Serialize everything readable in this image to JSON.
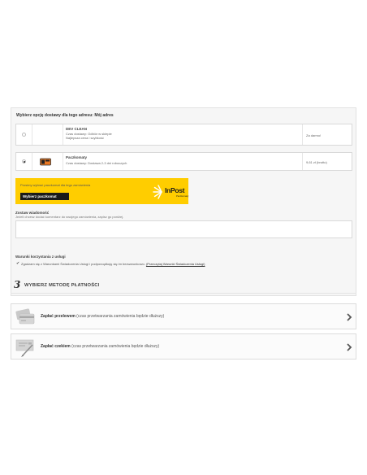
{
  "delivery": {
    "heading": "Wybierz opcję dostawy dla tego adresu: Mój adres",
    "carriers": [
      {
        "name": "DEV CLEAN",
        "desc1": "Czas dostawy: Odbiór w sklepie",
        "desc2": "Najlepsza cena i szybkość",
        "price": "Za darmo!",
        "selected": false
      },
      {
        "name": "Paczkomaty",
        "desc1": "Czas dostawy: Dostawa 2-3 dni roboczych",
        "desc2": "",
        "price": "9,61 zł (brutto)",
        "selected": true
      }
    ],
    "inpost": {
      "notice": "Prosimy wybrać paczkomat dla tego zamówienia",
      "button_label": "Wybierz paczkomat",
      "logo_text": "InPost",
      "logo_sub": "Paczkomaty"
    },
    "message": {
      "title": "Zostaw wiadomość",
      "hint": "Jeżeli chcesz dodać komentarz do swojego zamówienia, zapisz go poniżej."
    },
    "terms": {
      "title": "Warunki korzystania z usługi",
      "text": "Zgadzam się z Warunkami Świadczenia Usługi i podporządkuję się im bezwarunkowo.",
      "link": "(Przeczytaj Warunki Świadczenia Usługi)",
      "checked": true
    }
  },
  "payment": {
    "step_number": "3",
    "step_title": "WYBIERZ METODĘ PŁATNOŚCI",
    "options": [
      {
        "bold": "Zapłać przelewem",
        "rest": " (czas przetwarzania zamówienia będzie dłuższy)",
        "icon": "credit-card-icon"
      },
      {
        "bold": "Zapłać czekiem",
        "rest": " (czas przetwarzania zamówienia będzie dłuższy)",
        "icon": "cheque-icon"
      }
    ]
  },
  "colors": {
    "inpost_yellow": "#ffcd00",
    "dark": "#1a1a1a"
  }
}
